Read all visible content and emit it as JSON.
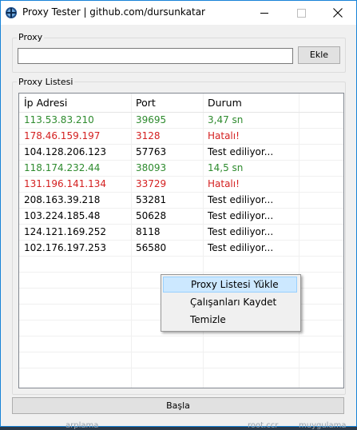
{
  "window": {
    "title": "Proxy Tester | github.com/dursunkatar"
  },
  "proxy_group": {
    "label": "Proxy",
    "input_value": "",
    "add_button": "Ekle"
  },
  "list_group": {
    "label": "Proxy Listesi",
    "columns": [
      "İp Adresi",
      "Port",
      "Durum"
    ],
    "rows": [
      {
        "ip": "113.53.83.210",
        "port": "39695",
        "status": "3,47 sn",
        "color": "#2e8b2e"
      },
      {
        "ip": "178.46.159.197",
        "port": "3128",
        "status": "Hatalı!",
        "color": "#d42020"
      },
      {
        "ip": "104.128.206.123",
        "port": "57763",
        "status": "Test ediliyor...",
        "color": "#000000"
      },
      {
        "ip": "118.174.232.44",
        "port": "38093",
        "status": "14,5 sn",
        "color": "#2e8b2e"
      },
      {
        "ip": "131.196.141.134",
        "port": "33729",
        "status": "Hatalı!",
        "color": "#d42020"
      },
      {
        "ip": "208.163.39.218",
        "port": "53281",
        "status": "Test ediliyor...",
        "color": "#000000"
      },
      {
        "ip": "103.224.185.48",
        "port": "50628",
        "status": "Test ediliyor...",
        "color": "#000000"
      },
      {
        "ip": "124.121.169.252",
        "port": "8118",
        "status": "Test ediliyor...",
        "color": "#000000"
      },
      {
        "ip": "102.176.197.253",
        "port": "56580",
        "status": "Test ediliyor...",
        "color": "#000000"
      }
    ]
  },
  "context_menu": {
    "items": [
      "Proxy Listesi Yükle",
      "Çalışanları Kaydet",
      "Temizle"
    ],
    "highlighted_index": 0
  },
  "start_button": "Başla",
  "background_fragments": [
    "arplama",
    "root.ccr",
    "muygulama"
  ]
}
